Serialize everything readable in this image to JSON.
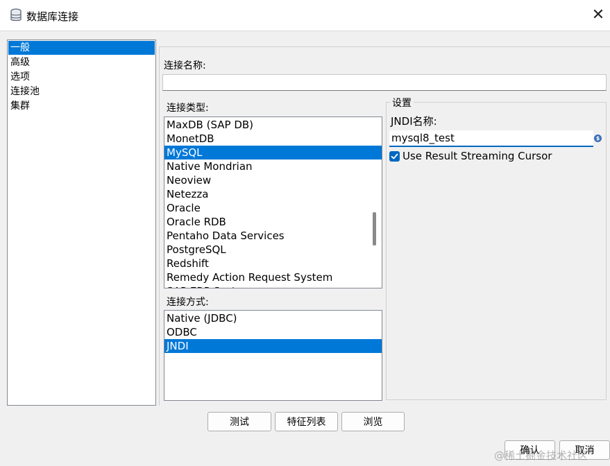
{
  "window": {
    "title": "数据库连接",
    "icon": "database-icon",
    "close_glyph": "✕"
  },
  "nav": {
    "items": [
      {
        "label": "一般",
        "selected": true
      },
      {
        "label": "高级",
        "selected": false
      },
      {
        "label": "选项",
        "selected": false
      },
      {
        "label": "连接池",
        "selected": false
      },
      {
        "label": "集群",
        "selected": false
      }
    ]
  },
  "form": {
    "connection_name_label": "连接名称:",
    "connection_name_value": "",
    "connection_type_label": "连接类型:",
    "connection_types": [
      {
        "label": "MaxDB (SAP DB)",
        "selected": false
      },
      {
        "label": "MonetDB",
        "selected": false
      },
      {
        "label": "MySQL",
        "selected": true
      },
      {
        "label": "Native Mondrian",
        "selected": false
      },
      {
        "label": "Neoview",
        "selected": false
      },
      {
        "label": "Netezza",
        "selected": false
      },
      {
        "label": "Oracle",
        "selected": false
      },
      {
        "label": "Oracle RDB",
        "selected": false
      },
      {
        "label": "Pentaho Data Services",
        "selected": false
      },
      {
        "label": "PostgreSQL",
        "selected": false
      },
      {
        "label": "Redshift",
        "selected": false
      },
      {
        "label": "Remedy Action Request System",
        "selected": false
      },
      {
        "label": "SAP ERP System",
        "selected": false
      }
    ],
    "access_label": "连接方式:",
    "access_methods": [
      {
        "label": "Native (JDBC)",
        "selected": false
      },
      {
        "label": "ODBC",
        "selected": false
      },
      {
        "label": "JNDI",
        "selected": true
      }
    ]
  },
  "settings": {
    "legend": "设置",
    "jndi_label": "JNDI名称:",
    "jndi_value": "mysql8_test",
    "variable_icon": "variable-icon",
    "streaming_cursor_label": "Use Result Streaming Cursor",
    "streaming_cursor_checked": true
  },
  "buttons": {
    "test": "测试",
    "features": "特征列表",
    "explore": "浏览",
    "ok": "确认",
    "cancel": "取消"
  },
  "watermark": "@稀土掘金技术社区",
  "colors": {
    "selection": "#0078d7",
    "accent": "#0067c0",
    "background": "#f0f0f0"
  }
}
